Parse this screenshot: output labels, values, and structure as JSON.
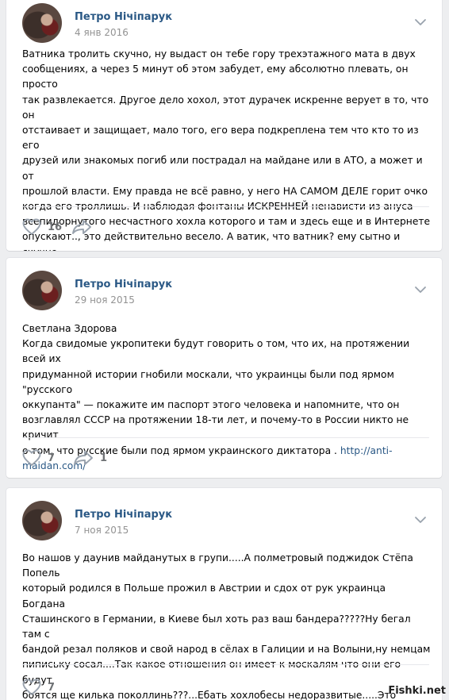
{
  "posts": [
    {
      "author": "Петро Нічіпарук",
      "date": "4 янв 2016",
      "text": "Ватника тролить скучно, ну выдаст он тебе гору трехэтажного мата в двух\nсообщениях, а через 5 минут об этом забудет, ему абсолютно плевать, он просто\nтак развлекается. Другое дело хохол, этот дурачек искренне верует в то, что он\nотстаивает и защищает, мало того, его вера подкреплена тем что кто то из его\nдрузей или знакомых погиб или пострадал на майдане или в АТО, а может и от\nпрошлой власти. Ему правда не всё равно, у него НА САМОМ ДЕЛЕ горит очко\nкогда его троллишь. И наблюдая фонтаны ИСКРЕННЕЙ ненависти из ануса\nвсепидорнутого несчастного хохла которого и там и здесь еще и в Интернете\nопускают.., это действительно весело. А ватик, что ватник? ему сытно и скучно,\nему похуй.",
      "link": "",
      "likes": "16",
      "shares": ""
    },
    {
      "author": "Петро Нічіпарук",
      "date": "29 ноя 2015",
      "text": "Светлана Здорова\nКогда свидомые укропитеки будут говорить о том, что их, на протяжении всей их\nпридуманной истории гнобили москали, что украинцы были под ярмом \"русского\nоккупанта\" — покажите им паспорт этого человека и напомните, что он\nвозглавлял СССР на протяжении 18-ти лет, и почему-то в России никто не кричит\nо том, что русские были под ярмом украинского диктатора . ",
      "link": "http://anti-\nmaidan.com/",
      "likes": "7",
      "shares": "1"
    },
    {
      "author": "Петро Нічіпарук",
      "date": "7 ноя 2015",
      "text": "Во нашов у даунив майданутых в групи.....А полметровый поджидок Стёпа Попель\nкоторый родился в Польше прожил в Австрии и сдох от рук украинца Богдана\nСташинского в Германии, в Киеве был хоть раз ваш бандера?????Ну бегал там с\nбандой резал поляков и свой народ в сёлах в Галиции и на Волыни,ну немцам\nпипиську сосал....Так какое отношения он имеет к москалям что они его будут\nбоятся ще килька поколлинь???...Ебать хохлобесы недоразвитые.....Это чучело\nдаже похоронено в Германии....",
      "link": "",
      "likes": "7",
      "shares": ""
    }
  ],
  "icons": {
    "like": "heart-icon",
    "share": "share-arrow-icon",
    "menu": "chevron-down-icon"
  },
  "colors": {
    "background": "#edeef0",
    "author": "#2a5885",
    "date": "#939393",
    "icon": "#99a2ad"
  },
  "watermark": "Fishki.net"
}
